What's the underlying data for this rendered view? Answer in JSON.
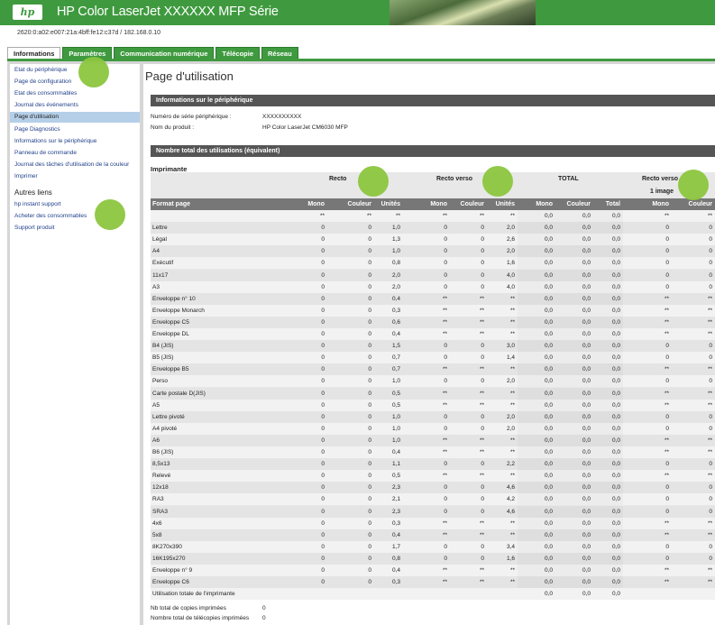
{
  "header": {
    "logo": "hp",
    "title": "HP Color LaserJet XXXXXX MFP Série"
  },
  "address": "2620:0:a02:e007:21a:4bff:fe12:c37d / 182.168.0.10",
  "tabs": [
    "Informations",
    "Paramètres",
    "Communication numérique",
    "Télécopie",
    "Réseau"
  ],
  "sidebar": {
    "items": [
      "Etat du périphérique",
      "Page de configuration",
      "Etat des consommables",
      "Journal des événements",
      "Page d'utilisation",
      "Page Diagnostics",
      "Informations sur le périphérique",
      "Panneau de commande",
      "Journal des tâches d'utilisation de la couleur",
      "Imprimer"
    ],
    "links_title": "Autres liens",
    "links": [
      "hp instant support",
      "Acheter des consommables",
      "Support produit"
    ]
  },
  "page_title": "Page d'utilisation",
  "device_info": {
    "section": "Informations sur le périphérique",
    "serial_label": "Numéro de série périphérique :",
    "serial_value": "XXXXXXXXXX",
    "product_label": "Nom du produit :",
    "product_value": "HP Color LaserJet CM6030 MFP"
  },
  "usage": {
    "section": "Nombre total des utilisations (équivalent)",
    "printer": "Imprimante",
    "groups": [
      "Recto",
      "Recto verso",
      "TOTAL",
      "Recto verso"
    ],
    "sub": "1 image",
    "columns": [
      "Format page",
      "Mono",
      "Couleur",
      "Unités",
      "Mono",
      "Couleur",
      "Unités",
      "Mono",
      "Couleur",
      "Total",
      "Mono",
      "Couleur"
    ],
    "rows": [
      [
        "",
        "**",
        "**",
        "**",
        "**",
        "**",
        "**",
        "0,0",
        "0,0",
        "0,0",
        "**",
        "**"
      ],
      [
        "Lettre",
        "0",
        "0",
        "1,0",
        "0",
        "0",
        "2,0",
        "0,0",
        "0,0",
        "0,0",
        "0",
        "0"
      ],
      [
        "Légal",
        "0",
        "0",
        "1,3",
        "0",
        "0",
        "2,6",
        "0,0",
        "0,0",
        "0,0",
        "0",
        "0"
      ],
      [
        "A4",
        "0",
        "0",
        "1,0",
        "0",
        "0",
        "2,0",
        "0,0",
        "0,0",
        "0,0",
        "0",
        "0"
      ],
      [
        "Exécutif",
        "0",
        "0",
        "0,8",
        "0",
        "0",
        "1,6",
        "0,0",
        "0,0",
        "0,0",
        "0",
        "0"
      ],
      [
        "11x17",
        "0",
        "0",
        "2,0",
        "0",
        "0",
        "4,0",
        "0,0",
        "0,0",
        "0,0",
        "0",
        "0"
      ],
      [
        "A3",
        "0",
        "0",
        "2,0",
        "0",
        "0",
        "4,0",
        "0,0",
        "0,0",
        "0,0",
        "0",
        "0"
      ],
      [
        "Enveloppe n° 10",
        "0",
        "0",
        "0,4",
        "**",
        "**",
        "**",
        "0,0",
        "0,0",
        "0,0",
        "**",
        "**"
      ],
      [
        "Enveloppe Monarch",
        "0",
        "0",
        "0,3",
        "**",
        "**",
        "**",
        "0,0",
        "0,0",
        "0,0",
        "**",
        "**"
      ],
      [
        "Enveloppe C5",
        "0",
        "0",
        "0,6",
        "**",
        "**",
        "**",
        "0,0",
        "0,0",
        "0,0",
        "**",
        "**"
      ],
      [
        "Enveloppe DL",
        "0",
        "0",
        "0,4",
        "**",
        "**",
        "**",
        "0,0",
        "0,0",
        "0,0",
        "**",
        "**"
      ],
      [
        "B4 (JIS)",
        "0",
        "0",
        "1,5",
        "0",
        "0",
        "3,0",
        "0,0",
        "0,0",
        "0,0",
        "0",
        "0"
      ],
      [
        "B5 (JIS)",
        "0",
        "0",
        "0,7",
        "0",
        "0",
        "1,4",
        "0,0",
        "0,0",
        "0,0",
        "0",
        "0"
      ],
      [
        "Enveloppe B5",
        "0",
        "0",
        "0,7",
        "**",
        "**",
        "**",
        "0,0",
        "0,0",
        "0,0",
        "**",
        "**"
      ],
      [
        "Perso",
        "0",
        "0",
        "1,0",
        "0",
        "0",
        "2,0",
        "0,0",
        "0,0",
        "0,0",
        "0",
        "0"
      ],
      [
        "Carte postale D(JIS)",
        "0",
        "0",
        "0,5",
        "**",
        "**",
        "**",
        "0,0",
        "0,0",
        "0,0",
        "**",
        "**"
      ],
      [
        "A5",
        "0",
        "0",
        "0,5",
        "**",
        "**",
        "**",
        "0,0",
        "0,0",
        "0,0",
        "**",
        "**"
      ],
      [
        "Lettre pivoté",
        "0",
        "0",
        "1,0",
        "0",
        "0",
        "2,0",
        "0,0",
        "0,0",
        "0,0",
        "0",
        "0"
      ],
      [
        "A4 pivoté",
        "0",
        "0",
        "1,0",
        "0",
        "0",
        "2,0",
        "0,0",
        "0,0",
        "0,0",
        "0",
        "0"
      ],
      [
        "A6",
        "0",
        "0",
        "1,0",
        "**",
        "**",
        "**",
        "0,0",
        "0,0",
        "0,0",
        "**",
        "**"
      ],
      [
        "B6 (JIS)",
        "0",
        "0",
        "0,4",
        "**",
        "**",
        "**",
        "0,0",
        "0,0",
        "0,0",
        "**",
        "**"
      ],
      [
        "8,5x13",
        "0",
        "0",
        "1,1",
        "0",
        "0",
        "2,2",
        "0,0",
        "0,0",
        "0,0",
        "0",
        "0"
      ],
      [
        "Relevé",
        "0",
        "0",
        "0,5",
        "**",
        "**",
        "**",
        "0,0",
        "0,0",
        "0,0",
        "**",
        "**"
      ],
      [
        "12x18",
        "0",
        "0",
        "2,3",
        "0",
        "0",
        "4,6",
        "0,0",
        "0,0",
        "0,0",
        "0",
        "0"
      ],
      [
        "RA3",
        "0",
        "0",
        "2,1",
        "0",
        "0",
        "4,2",
        "0,0",
        "0,0",
        "0,0",
        "0",
        "0"
      ],
      [
        "SRA3",
        "0",
        "0",
        "2,3",
        "0",
        "0",
        "4,6",
        "0,0",
        "0,0",
        "0,0",
        "0",
        "0"
      ],
      [
        "4x6",
        "0",
        "0",
        "0,3",
        "**",
        "**",
        "**",
        "0,0",
        "0,0",
        "0,0",
        "**",
        "**"
      ],
      [
        "5x8",
        "0",
        "0",
        "0,4",
        "**",
        "**",
        "**",
        "0,0",
        "0,0",
        "0,0",
        "**",
        "**"
      ],
      [
        "8K270x390",
        "0",
        "0",
        "1,7",
        "0",
        "0",
        "3,4",
        "0,0",
        "0,0",
        "0,0",
        "0",
        "0"
      ],
      [
        "16K195x270",
        "0",
        "0",
        "0,8",
        "0",
        "0",
        "1,6",
        "0,0",
        "0,0",
        "0,0",
        "0",
        "0"
      ],
      [
        "Enveloppe n° 9",
        "0",
        "0",
        "0,4",
        "**",
        "**",
        "**",
        "0,0",
        "0,0",
        "0,0",
        "**",
        "**"
      ],
      [
        "Enveloppe C6",
        "0",
        "0",
        "0,3",
        "**",
        "**",
        "**",
        "0,0",
        "0,0",
        "0,0",
        "**",
        "**"
      ]
    ],
    "total_row": [
      "Utilisation totale de l'imprimante",
      "0,0",
      "0,0",
      "0,0"
    ]
  },
  "bottom": [
    {
      "label": "Nb total de copies imprimées",
      "value": "0"
    },
    {
      "label": "Nombre total de télécopies imprimées",
      "value": "0"
    }
  ]
}
